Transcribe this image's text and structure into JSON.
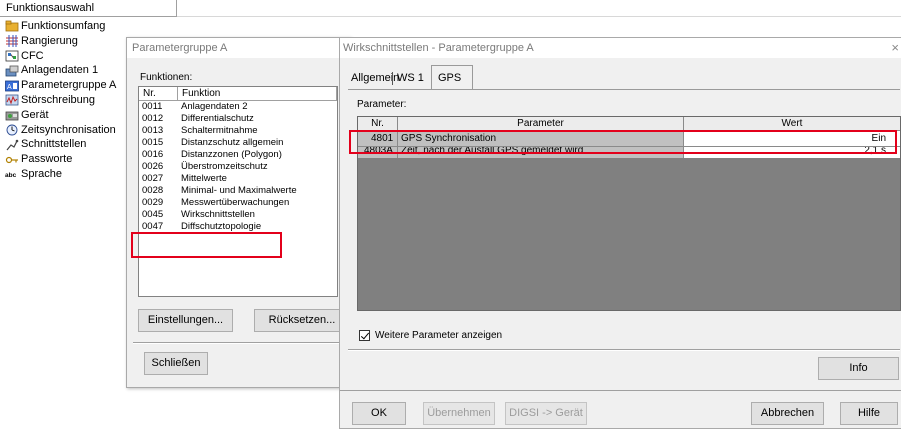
{
  "tree": {
    "header": "Funktionsauswahl",
    "items": [
      {
        "label": "Funktionsumfang",
        "icon": "folder-icon"
      },
      {
        "label": "Rangierung",
        "icon": "grid-icon"
      },
      {
        "label": "CFC",
        "icon": "cfc-icon"
      },
      {
        "label": "Anlagendaten 1",
        "icon": "plant-icon"
      },
      {
        "label": "Parametergruppe A",
        "icon": "param-group-icon"
      },
      {
        "label": "Störschreibung",
        "icon": "recorder-icon"
      },
      {
        "label": "Gerät",
        "icon": "device-icon"
      },
      {
        "label": "Zeitsynchronisation",
        "icon": "clock-icon"
      },
      {
        "label": "Schnittstellen",
        "icon": "interface-icon"
      },
      {
        "label": "Passworte",
        "icon": "key-icon"
      },
      {
        "label": "Sprache",
        "icon": "language-icon"
      }
    ]
  },
  "param_group_dialog": {
    "title": "Parametergruppe A",
    "functions_label": "Funktionen:",
    "columns": [
      "Nr.",
      "Funktion"
    ],
    "rows": [
      {
        "nr": "0011",
        "name": "Anlagendaten 2"
      },
      {
        "nr": "0012",
        "name": "Differentialschutz"
      },
      {
        "nr": "0013",
        "name": "Schaltermitnahme"
      },
      {
        "nr": "0015",
        "name": "Distanzschutz allgemein"
      },
      {
        "nr": "0016",
        "name": "Distanzzonen (Polygon)"
      },
      {
        "nr": "0026",
        "name": "Überstromzeitschutz"
      },
      {
        "nr": "0027",
        "name": "Mittelwerte"
      },
      {
        "nr": "0028",
        "name": "Minimal- und Maximalwerte"
      },
      {
        "nr": "0029",
        "name": "Messwertüberwachungen"
      },
      {
        "nr": "0045",
        "name": "Wirkschnittstellen"
      },
      {
        "nr": "0047",
        "name": "Diffschutztopologie"
      }
    ],
    "settings_button": "Einstellungen...",
    "reset_button": "Rücksetzen...",
    "close_button": "Schließen"
  },
  "wirk_dialog": {
    "title": "Wirkschnittstellen - Parametergruppe A",
    "close_glyph": "×",
    "tabs": [
      "Allgemein",
      "WS 1",
      "GPS"
    ],
    "active_tab": "GPS",
    "parameter_label": "Parameter:",
    "columns": [
      "Nr.",
      "Parameter",
      "Wert"
    ],
    "rows": [
      {
        "nr": "4801",
        "parameter": "GPS Synchronisation",
        "value": "Ein"
      },
      {
        "nr": "4803A",
        "parameter": "Zeit, nach der Ausfall GPS gemeldet wird",
        "value": "2,1 s"
      }
    ],
    "more_params_label": "Weitere Parameter anzeigen",
    "more_params_checked": true,
    "info_button": "Info",
    "ok_button": "OK",
    "apply_button": "Übernehmen",
    "digsi_button": "DIGSI -> Gerät",
    "cancel_button": "Abbrechen",
    "help_button": "Hilfe"
  },
  "colors": {
    "highlight": "#e3001b",
    "grid_background": "#808080",
    "dialog_background": "#f0f0f0"
  }
}
